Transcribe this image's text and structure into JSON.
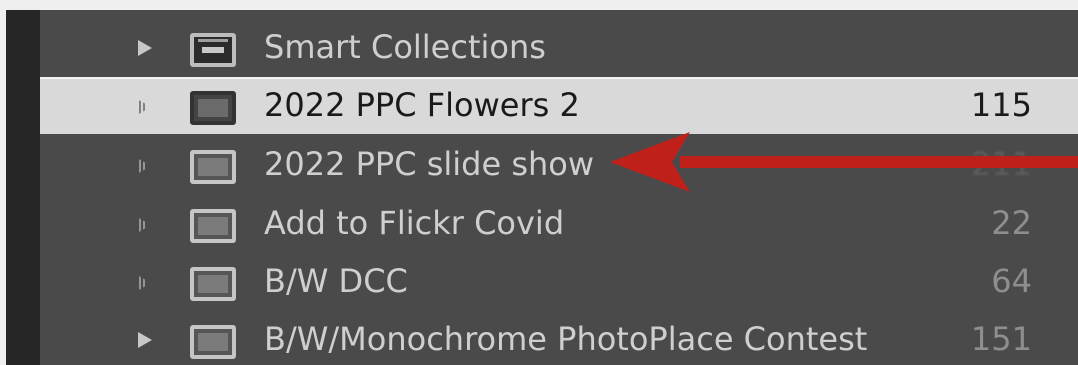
{
  "collections_panel": {
    "items": [
      {
        "label": "Smart Collections",
        "count": "",
        "icon": "smart-collection-set-icon",
        "expander": "solid"
      },
      {
        "label": "2022 PPC Flowers 2",
        "count": "115",
        "icon": "collection-icon",
        "expander": "dotted",
        "selected": true
      },
      {
        "label": "2022 PPC slide show",
        "count": "211",
        "icon": "collection-icon",
        "expander": "dotted"
      },
      {
        "label": "Add to Flickr Covid",
        "count": "22",
        "icon": "collection-icon",
        "expander": "dotted"
      },
      {
        "label": "B/W DCC",
        "count": "64",
        "icon": "collection-icon",
        "expander": "dotted"
      },
      {
        "label": "B/W/Monochrome PhotoPlace Contest",
        "count": "151",
        "icon": "collection-icon",
        "expander": "solid"
      }
    ]
  },
  "annotation": {
    "arrow_color": "#c0201a",
    "points_to": "2022 PPC slide show"
  },
  "colors": {
    "panel_background": "#4a4a4a",
    "selected_row": "#d9d9d9",
    "text": "#cfcfcf"
  }
}
